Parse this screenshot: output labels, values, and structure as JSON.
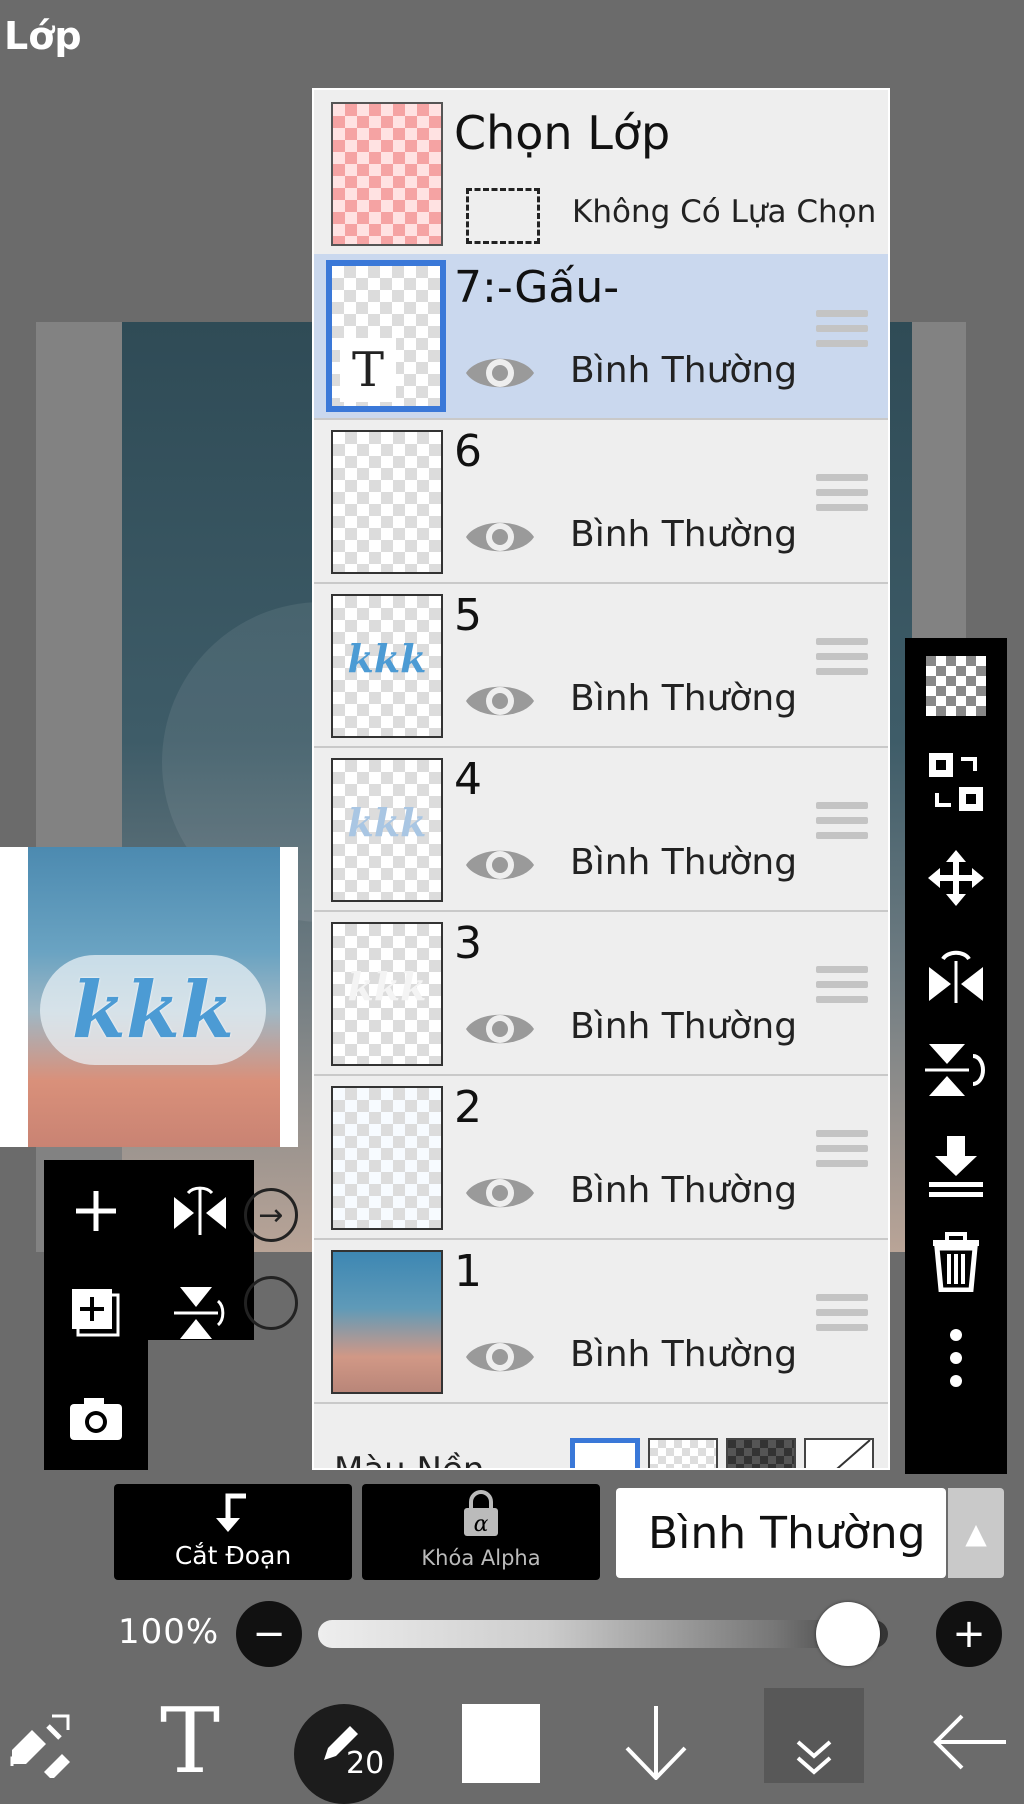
{
  "header": {
    "title": "Lớp"
  },
  "preview": {
    "text": "kkk"
  },
  "selection": {
    "title": "Chọn Lớp",
    "status": "Không Có Lựa Chọn"
  },
  "layers": [
    {
      "name": "7:-Gấu-",
      "blend": "Bình Thường",
      "type": "text",
      "selected": true,
      "thumb_glyph": "T"
    },
    {
      "name": "6",
      "blend": "Bình Thường",
      "type": "raster",
      "thumb_glyph": ""
    },
    {
      "name": "5",
      "blend": "Bình Thường",
      "type": "raster",
      "thumb_glyph": "kkk"
    },
    {
      "name": "4",
      "blend": "Bình Thường",
      "type": "raster",
      "thumb_glyph": "kkk"
    },
    {
      "name": "3",
      "blend": "Bình Thường",
      "type": "raster",
      "thumb_glyph": "kkk"
    },
    {
      "name": "2",
      "blend": "Bình Thường",
      "type": "raster",
      "thumb_glyph": ""
    },
    {
      "name": "1",
      "blend": "Bình Thường",
      "type": "raster",
      "thumb_glyph": ""
    }
  ],
  "background": {
    "label": "Màu Nền"
  },
  "controls": {
    "clipping_label": "Cắt Đoạn",
    "alpha_lock_label": "Khóa Alpha",
    "blend_mode": "Bình Thường",
    "opacity": "100%",
    "opacity_value": 1.0
  },
  "toolbar": {
    "brush_size": "20"
  },
  "colors": {
    "accent": "#3a78d8",
    "selected_row": "#cad8ee",
    "panel": "#eeeeee"
  }
}
